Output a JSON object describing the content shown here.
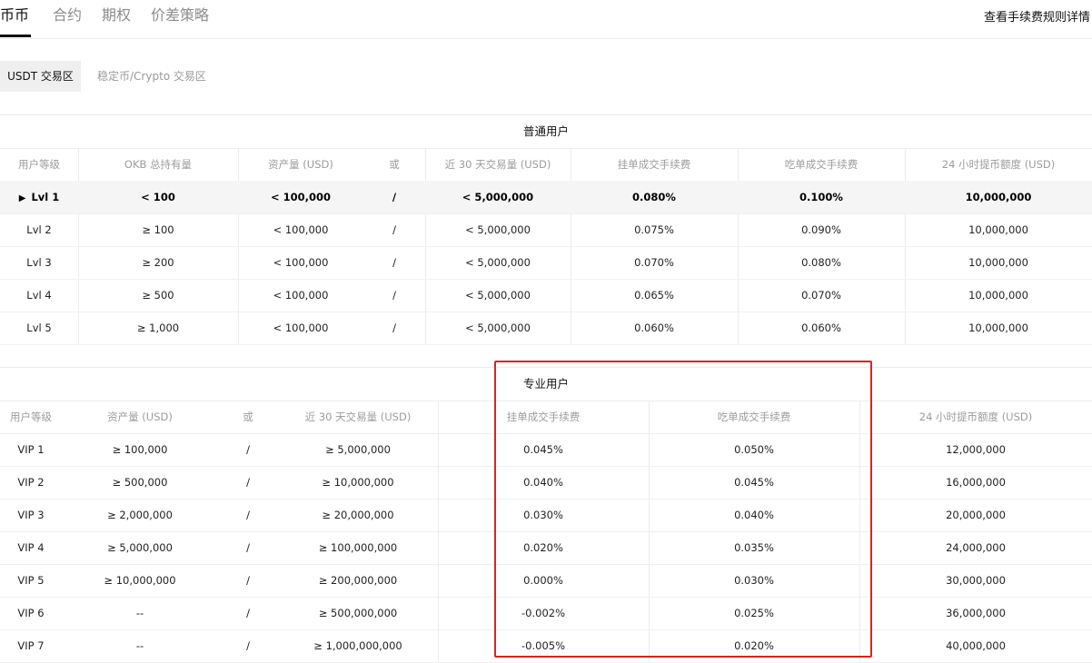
{
  "nav": {
    "tabs": [
      {
        "label": "币币",
        "active": true
      },
      {
        "label": "合约",
        "active": false
      },
      {
        "label": "期权",
        "active": false
      },
      {
        "label": "价差策略",
        "active": false
      }
    ],
    "fee_rules_link": "查看手续费规则详情"
  },
  "subtabs": [
    {
      "label": "USDT 交易区",
      "active": true
    },
    {
      "label": "稳定币/Crypto 交易区",
      "active": false
    }
  ],
  "regular": {
    "title": "普通用户",
    "headers": [
      "用户等级",
      "OKB 总持有量",
      "资产量 (USD)",
      "或",
      "近 30 天交易量 (USD)",
      "挂单成交手续费",
      "吃单成交手续费",
      "24 小时提币额度 (USD)"
    ],
    "rows": [
      [
        "Lvl 1",
        "< 100",
        "< 100,000",
        "/",
        "< 5,000,000",
        "0.080%",
        "0.100%",
        "10,000,000"
      ],
      [
        "Lvl 2",
        "≥ 100",
        "< 100,000",
        "/",
        "< 5,000,000",
        "0.075%",
        "0.090%",
        "10,000,000"
      ],
      [
        "Lvl 3",
        "≥ 200",
        "< 100,000",
        "/",
        "< 5,000,000",
        "0.070%",
        "0.080%",
        "10,000,000"
      ],
      [
        "Lvl 4",
        "≥ 500",
        "< 100,000",
        "/",
        "< 5,000,000",
        "0.065%",
        "0.070%",
        "10,000,000"
      ],
      [
        "Lvl 5",
        "≥ 1,000",
        "< 100,000",
        "/",
        "< 5,000,000",
        "0.060%",
        "0.060%",
        "10,000,000"
      ]
    ],
    "current_level_marker": "▶"
  },
  "pro": {
    "title": "专业用户",
    "headers": [
      "用户等级",
      "资产量 (USD)",
      "或",
      "近 30 天交易量 (USD)",
      "挂单成交手续费",
      "吃单成交手续费",
      "24 小时提币额度 (USD)"
    ],
    "rows": [
      [
        "VIP 1",
        "≥ 100,000",
        "/",
        "≥ 5,000,000",
        "0.045%",
        "0.050%",
        "12,000,000"
      ],
      [
        "VIP 2",
        "≥ 500,000",
        "/",
        "≥ 10,000,000",
        "0.040%",
        "0.045%",
        "16,000,000"
      ],
      [
        "VIP 3",
        "≥ 2,000,000",
        "/",
        "≥ 20,000,000",
        "0.030%",
        "0.040%",
        "20,000,000"
      ],
      [
        "VIP 4",
        "≥ 5,000,000",
        "/",
        "≥ 100,000,000",
        "0.020%",
        "0.035%",
        "24,000,000"
      ],
      [
        "VIP 5",
        "≥ 10,000,000",
        "/",
        "≥ 200,000,000",
        "0.000%",
        "0.030%",
        "30,000,000"
      ],
      [
        "VIP 6",
        "--",
        "/",
        "≥ 500,000,000",
        "-0.002%",
        "0.025%",
        "36,000,000"
      ],
      [
        "VIP 7",
        "--",
        "/",
        "≥ 1,000,000,000",
        "-0.005%",
        "0.020%",
        "40,000,000"
      ]
    ]
  },
  "colors": {
    "annotation": "#e02020",
    "highlight_row": "#f5f5f5"
  }
}
